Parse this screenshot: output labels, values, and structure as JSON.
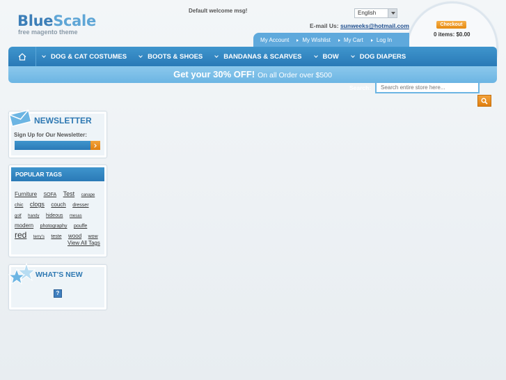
{
  "header": {
    "logo_blue": "Blue",
    "logo_scale": "Scale",
    "tagline": "free magento theme",
    "welcome": "Default welcome msg!",
    "language": "English",
    "email_label": "E-mail Us:",
    "email": "sunweeks@hotmail.com"
  },
  "cart": {
    "checkout_label": "Checkout",
    "summary": "0 items: $0.00"
  },
  "account_links": [
    {
      "label": "My Account"
    },
    {
      "label": "My Wishlist"
    },
    {
      "label": "My Cart"
    },
    {
      "label": "Log In"
    }
  ],
  "nav": {
    "home_icon": "home-icon",
    "items": [
      {
        "label": "DOG & CAT COSTUMES"
      },
      {
        "label": "BOOTS & SHOES"
      },
      {
        "label": "BANDANAS & SCARVES"
      },
      {
        "label": "BOW"
      },
      {
        "label": "DOG DIAPERS"
      }
    ]
  },
  "promo": {
    "headline": "Get your 30% OFF!",
    "subline": "On all Order over $500"
  },
  "search": {
    "label": "Search:",
    "placeholder": "Search entire store here..."
  },
  "newsletter": {
    "title": "NEWSLETTER",
    "label": "Sign Up for Our Newsletter:"
  },
  "popular_tags": {
    "title": "POPULAR TAGS",
    "tags": [
      {
        "label": "Furniture",
        "size": "t8"
      },
      {
        "label": "SOFA",
        "size": "t7"
      },
      {
        "label": "Test",
        "size": "t9"
      },
      {
        "label": "canape",
        "size": "t6"
      },
      {
        "label": "chic",
        "size": "t7"
      },
      {
        "label": "clogs",
        "size": "t9"
      },
      {
        "label": "couch",
        "size": "t8"
      },
      {
        "label": "dresser",
        "size": "t7"
      },
      {
        "label": "golf",
        "size": "t6"
      },
      {
        "label": "handy",
        "size": "t6"
      },
      {
        "label": "hideous",
        "size": "t7"
      },
      {
        "label": "mesas",
        "size": "t6"
      },
      {
        "label": "modern",
        "size": "t8"
      },
      {
        "label": "photography",
        "size": "t7"
      },
      {
        "label": "pouffe",
        "size": "t7"
      },
      {
        "label": "red",
        "size": "t12"
      },
      {
        "label": "terry's",
        "size": "t6"
      },
      {
        "label": "teste",
        "size": "t7"
      },
      {
        "label": "wood",
        "size": "t8"
      },
      {
        "label": "wow",
        "size": "t7"
      }
    ],
    "view_all": "View All Tags"
  },
  "whats_new": {
    "title": "WHAT'S NEW",
    "placeholder_glyph": "?"
  },
  "colors": {
    "primary_blue": "#2a7ab7",
    "light_blue": "#6cb5e3",
    "accent_orange": "#e58a12"
  }
}
